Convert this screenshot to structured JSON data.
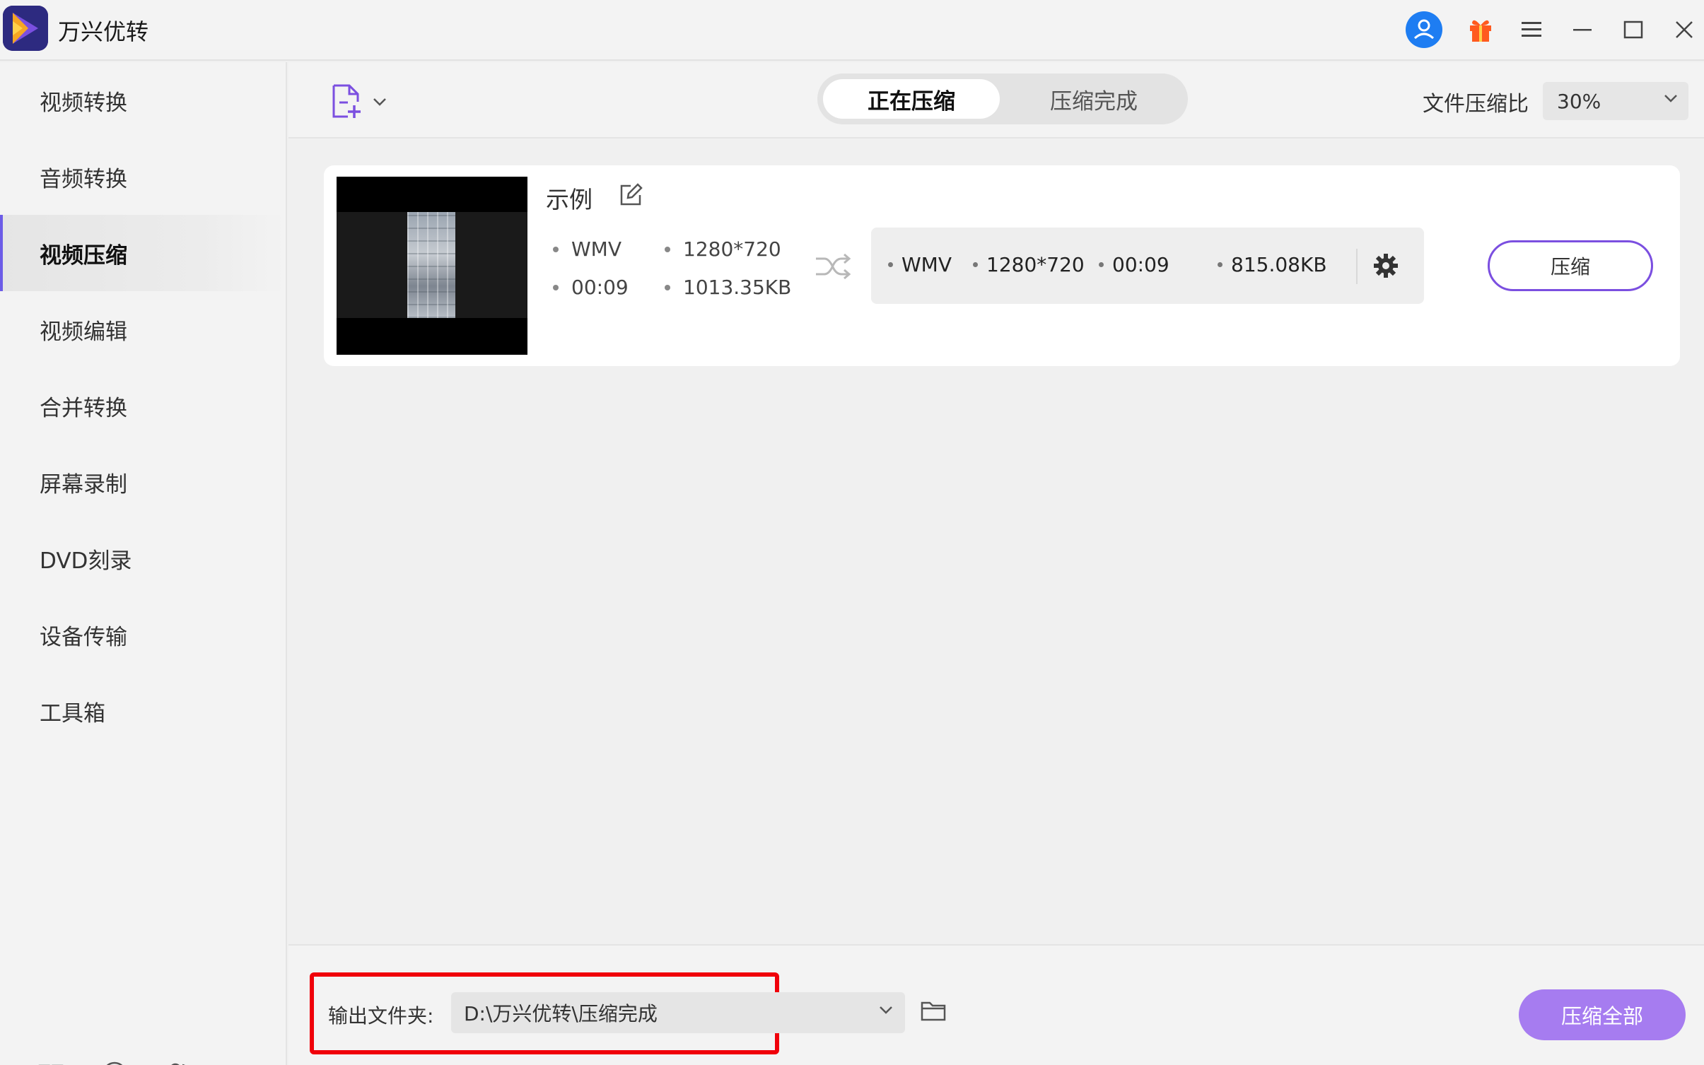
{
  "app": {
    "title": "万兴优转",
    "icons": [
      "app-logo-icon",
      "user-avatar-icon",
      "gift-icon",
      "menu-icon",
      "minimize-icon",
      "maximize-icon",
      "close-icon"
    ],
    "accent_color": "#7b4fe0",
    "avatar_color": "#1e7df2",
    "gift_color": "#ff5a1f"
  },
  "sidebar": {
    "items": [
      {
        "label": "视频转换"
      },
      {
        "label": "音频转换"
      },
      {
        "label": "视频压缩",
        "active": true
      },
      {
        "label": "视频编辑"
      },
      {
        "label": "合并转换"
      },
      {
        "label": "屏幕录制"
      },
      {
        "label": "DVD刻录"
      },
      {
        "label": "设备传输"
      },
      {
        "label": "工具箱"
      }
    ],
    "bottom_icons": [
      "book-icon",
      "help-icon",
      "users-icon"
    ]
  },
  "toolbar": {
    "add_file_icon": "add-file-icon",
    "tabs": [
      {
        "label": "正在压缩",
        "active": true
      },
      {
        "label": "压缩完成"
      }
    ],
    "ratio_label": "文件压缩比",
    "ratio_value": "30%"
  },
  "file": {
    "name": "示例",
    "source": {
      "format": "WMV",
      "resolution": "1280*720",
      "duration": "00:09",
      "size": "1013.35KB"
    },
    "output": {
      "format": "WMV",
      "resolution": "1280*720",
      "duration": "00:09",
      "size": "815.08KB"
    },
    "compress_label": "压缩"
  },
  "bottom": {
    "output_label": "输出文件夹:",
    "output_path": "D:\\万兴优转\\压缩完成",
    "compress_all_label": "压缩全部",
    "highlight_color": "#f0000a"
  }
}
